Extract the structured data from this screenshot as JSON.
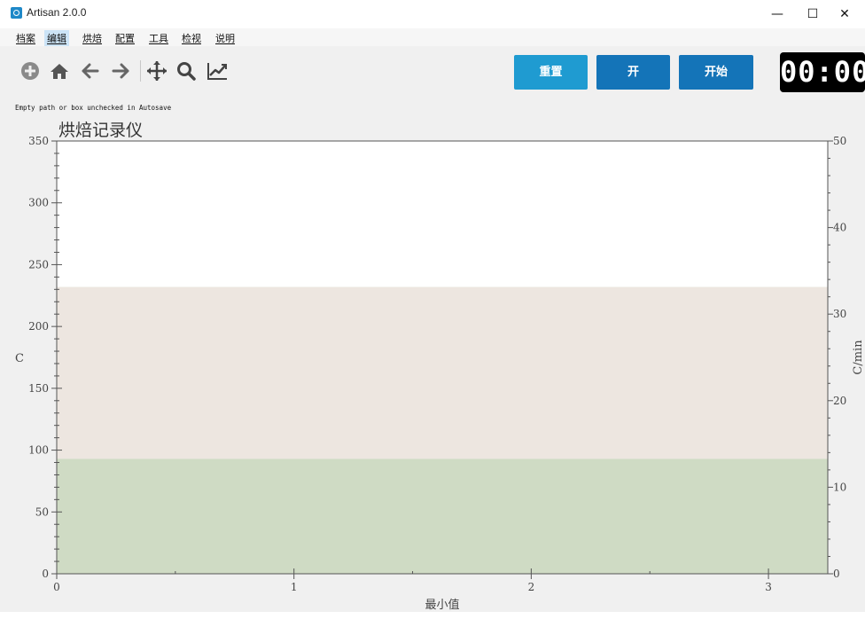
{
  "window": {
    "title": "Artisan 2.0.0",
    "controls": {
      "minimize": "—",
      "maximize": "☐",
      "close": "✕"
    }
  },
  "menu": {
    "items": [
      {
        "label": "档案"
      },
      {
        "label": "编辑"
      },
      {
        "label": "烘焙"
      },
      {
        "label": "配置"
      },
      {
        "label": "工具"
      },
      {
        "label": "检视"
      },
      {
        "label": "说明"
      }
    ]
  },
  "toolbar": {
    "icons": [
      "plus-circle-icon",
      "home-icon",
      "arrow-left-icon",
      "arrow-right-icon",
      "move-icon",
      "zoom-icon",
      "chart-line-icon"
    ]
  },
  "buttons": {
    "reset": {
      "label": "重置",
      "color": "#1f9bd1"
    },
    "on": {
      "label": "开",
      "color": "#1474b8"
    },
    "start": {
      "label": "开始",
      "color": "#1474b8"
    }
  },
  "timer": {
    "display": "00:00"
  },
  "status": {
    "message": "Empty path or box unchecked in Autosave"
  },
  "chart_data": {
    "type": "area",
    "title": "烘焙记录仪",
    "xlabel": "最小值",
    "ylabel": "C",
    "y2label": "C/min",
    "xlim": [
      0,
      3.25
    ],
    "ylim": [
      0,
      350
    ],
    "y2lim": [
      0,
      50
    ],
    "x_ticks": [
      "0",
      "1",
      "2",
      "3"
    ],
    "y_ticks": [
      "0",
      "50",
      "100",
      "150",
      "200",
      "250",
      "300",
      "350"
    ],
    "y2_ticks": [
      "0",
      "10",
      "20",
      "30",
      "40",
      "50"
    ],
    "bands": [
      {
        "from": 0,
        "to": 93,
        "color": "#cfdbc4"
      },
      {
        "from": 93,
        "to": 232,
        "color": "#ede6e0"
      },
      {
        "from": 232,
        "to": 350,
        "color": "#ffffff"
      }
    ],
    "grid": false
  }
}
